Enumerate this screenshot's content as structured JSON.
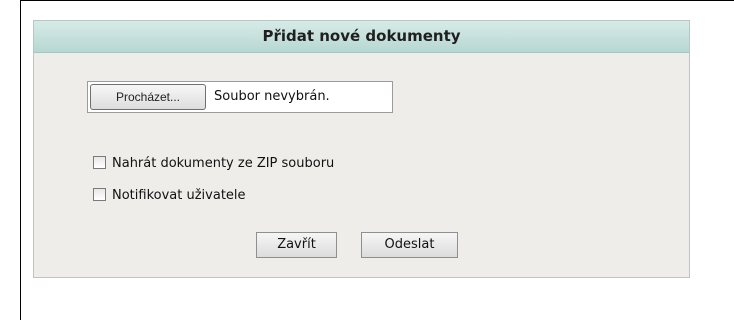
{
  "dialog": {
    "title": "Přidat nové dokumenty",
    "file_input": {
      "browse_label": "Procházet...",
      "status_text": "Soubor nevybrán."
    },
    "options": [
      {
        "label": "Nahrát dokumenty ze ZIP souboru",
        "checked": false
      },
      {
        "label": "Notifikovat uživatele",
        "checked": false
      }
    ],
    "buttons": {
      "close_label": "Zavřít",
      "submit_label": "Odeslat"
    }
  },
  "colors": {
    "header_bg": "#c5e2de",
    "dialog_bg": "#efedea",
    "border": "#b9c7c4"
  }
}
